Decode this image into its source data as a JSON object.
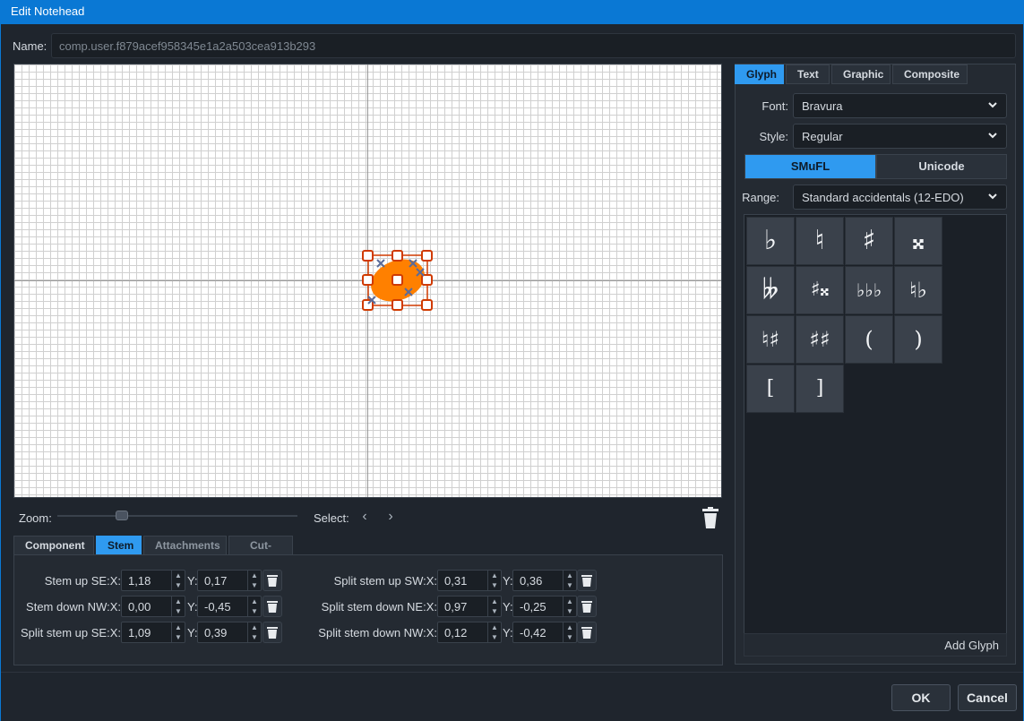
{
  "window": {
    "title": "Edit Notehead"
  },
  "name": {
    "label": "Name:",
    "value": "comp.user.f879acef958345e1a2a503cea913b293"
  },
  "canvas": {
    "zoom_label": "Zoom:",
    "zoom_level": 0.27,
    "select_label": "Select:",
    "notehead_color": "#ff8000"
  },
  "bottom_tabs": [
    "Component",
    "Stem",
    "Attachments",
    "Cut-outs"
  ],
  "bottom_active_tab": "Stem",
  "stem_left": [
    {
      "label": "Stem up SE:X:",
      "x": "1,18",
      "y": "0,17"
    },
    {
      "label": "Stem down NW:X:",
      "x": "0,00",
      "y": "-0,45"
    },
    {
      "label": "Split stem up SE:X:",
      "x": "1,09",
      "y": "0,39"
    }
  ],
  "stem_right": [
    {
      "label": "Split stem up SW:X:",
      "x": "0,31",
      "y": "0,36"
    },
    {
      "label": "Split stem down NE:X:",
      "x": "0,97",
      "y": "-0,25"
    },
    {
      "label": "Split stem down NW:X:",
      "x": "0,12",
      "y": "-0,42"
    }
  ],
  "y_label": "Y:",
  "right_tabs": [
    "Glyph",
    "Text",
    "Graphic",
    "Composite"
  ],
  "right_active_tab": "Glyph",
  "font": {
    "label": "Font:",
    "value": "Bravura"
  },
  "style": {
    "label": "Style:",
    "value": "Regular"
  },
  "encoding": {
    "smufl": "SMuFL",
    "unicode": "Unicode",
    "active": "SMuFL"
  },
  "range": {
    "label": "Range:",
    "value": "Standard accidentals (12-EDO)"
  },
  "glyphs": [
    "♭",
    "♮",
    "♯",
    "𝄪",
    "𝄫",
    "♯𝄪",
    "♭♭♭",
    "♮♭",
    "♮♯",
    "♯♯",
    "(",
    ")",
    "[",
    "]"
  ],
  "add_glyph": "Add Glyph",
  "buttons": {
    "ok": "OK",
    "cancel": "Cancel"
  },
  "accent": "#2f9af0"
}
